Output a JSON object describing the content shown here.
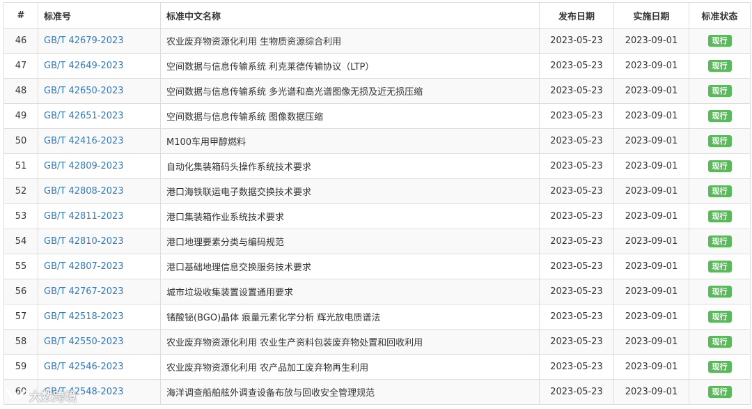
{
  "table": {
    "headers": {
      "num": "#",
      "code": "标准号",
      "name": "标准中文名称",
      "publish": "发布日期",
      "implement": "实施日期",
      "status": "标准状态"
    },
    "rows": [
      {
        "num": "46",
        "code": "GB/T 42679-2023",
        "name": "农业废弃物资源化利用 生物质资源综合利用",
        "publish": "2023-05-23",
        "implement": "2023-09-01",
        "status": "现行"
      },
      {
        "num": "47",
        "code": "GB/T 42649-2023",
        "name": "空间数据与信息传输系统 利克莱德传输协议（LTP）",
        "publish": "2023-05-23",
        "implement": "2023-09-01",
        "status": "现行"
      },
      {
        "num": "48",
        "code": "GB/T 42650-2023",
        "name": "空间数据与信息传输系统 多光谱和高光谱图像无损及近无损压缩",
        "publish": "2023-05-23",
        "implement": "2023-09-01",
        "status": "现行"
      },
      {
        "num": "49",
        "code": "GB/T 42651-2023",
        "name": "空间数据与信息传输系统 图像数据压缩",
        "publish": "2023-05-23",
        "implement": "2023-09-01",
        "status": "现行"
      },
      {
        "num": "50",
        "code": "GB/T 42416-2023",
        "name": "M100车用甲醇燃料",
        "publish": "2023-05-23",
        "implement": "2023-09-01",
        "status": "现行"
      },
      {
        "num": "51",
        "code": "GB/T 42809-2023",
        "name": "自动化集装箱码头操作系统技术要求",
        "publish": "2023-05-23",
        "implement": "2023-09-01",
        "status": "现行"
      },
      {
        "num": "52",
        "code": "GB/T 42808-2023",
        "name": "港口海铁联运电子数据交换技术要求",
        "publish": "2023-05-23",
        "implement": "2023-09-01",
        "status": "现行"
      },
      {
        "num": "53",
        "code": "GB/T 42811-2023",
        "name": "港口集装箱作业系统技术要求",
        "publish": "2023-05-23",
        "implement": "2023-09-01",
        "status": "现行"
      },
      {
        "num": "54",
        "code": "GB/T 42810-2023",
        "name": "港口地理要素分类与编码规范",
        "publish": "2023-05-23",
        "implement": "2023-09-01",
        "status": "现行"
      },
      {
        "num": "55",
        "code": "GB/T 42807-2023",
        "name": "港口基础地理信息交换服务技术要求",
        "publish": "2023-05-23",
        "implement": "2023-09-01",
        "status": "现行"
      },
      {
        "num": "56",
        "code": "GB/T 42767-2023",
        "name": "城市垃圾收集装置设置通用要求",
        "publish": "2023-05-23",
        "implement": "2023-09-01",
        "status": "现行"
      },
      {
        "num": "57",
        "code": "GB/T 42518-2023",
        "name": "锗酸铋(BGO)晶体 痕量元素化学分析 辉光放电质谱法",
        "publish": "2023-05-23",
        "implement": "2023-09-01",
        "status": "现行"
      },
      {
        "num": "58",
        "code": "GB/T 42550-2023",
        "name": "农业废弃物资源化利用 农业生产资料包装废弃物处置和回收利用",
        "publish": "2023-05-23",
        "implement": "2023-09-01",
        "status": "现行"
      },
      {
        "num": "59",
        "code": "GB/T 42546-2023",
        "name": "农业废弃物资源化利用 农产品加工废弃物再生利用",
        "publish": "2023-05-23",
        "implement": "2023-09-01",
        "status": "现行"
      },
      {
        "num": "60",
        "code": "GB/T 42548-2023",
        "name": "海洋调查船舶舷外调查设备布放与回收安全管理规范",
        "publish": "2023-05-23",
        "implement": "2023-09-01",
        "status": "现行"
      }
    ]
  },
  "watermark": {
    "text": "大数跨境",
    "icon": "wechat-channel-icon"
  },
  "colors": {
    "link": "#337ab7",
    "badge": "#5cb85c",
    "border": "#dddddd",
    "stripe": "#f9f9f9",
    "text": "#333333"
  }
}
